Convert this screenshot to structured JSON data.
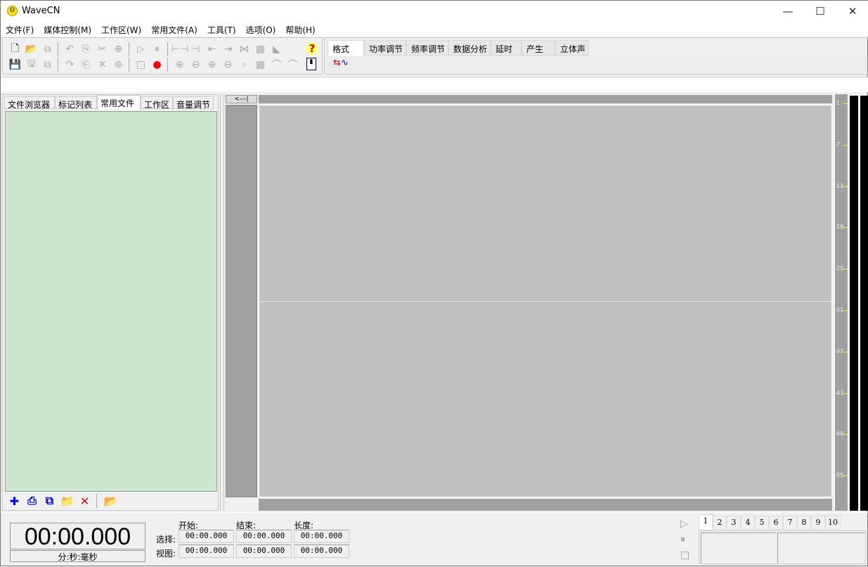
{
  "app": {
    "title": "WaveCN",
    "icon": "wavecn-logo-icon"
  },
  "window_controls": [
    {
      "name": "minimize-button",
      "glyph": "—"
    },
    {
      "name": "maximize-button",
      "glyph": "☐"
    },
    {
      "name": "close-button",
      "glyph": "✕"
    }
  ],
  "menu": [
    "文件(F)",
    "媒体控制(M)",
    "工作区(W)",
    "常用文件(A)",
    "工具(T)",
    "选项(O)",
    "帮助(H)"
  ],
  "toolbar": {
    "row1": [
      {
        "n": "new-file-icon",
        "g": "🗋",
        "c": "#000"
      },
      {
        "n": "open-folder-icon",
        "g": "📂",
        "c": "#c8b000"
      },
      {
        "n": "close-file-icon",
        "g": "⧉"
      },
      {
        "n": "sep"
      },
      {
        "n": "undo-icon",
        "g": "↶"
      },
      {
        "n": "copy-to-icon",
        "g": "⎘"
      },
      {
        "n": "cut-icon",
        "g": "✂"
      },
      {
        "n": "paste-new-icon",
        "g": "⊕"
      },
      {
        "n": "sep"
      },
      {
        "n": "play-icon",
        "g": "▷"
      },
      {
        "n": "pause-icon",
        "g": "⏸"
      },
      {
        "n": "sep"
      },
      {
        "n": "select-all-icon",
        "g": "⊢⊣"
      },
      {
        "n": "select-view-icon",
        "g": "⊣"
      },
      {
        "n": "select-start-icon",
        "g": "⇤"
      },
      {
        "n": "select-end-icon",
        "g": "⇥"
      },
      {
        "n": "select-range-icon",
        "g": "⋈"
      },
      {
        "n": "select-region-icon",
        "g": "▦"
      },
      {
        "n": "marker-icon",
        "g": "◣"
      }
    ],
    "row2": [
      {
        "n": "save-icon",
        "g": "💾"
      },
      {
        "n": "save-as-icon",
        "g": "🖫"
      },
      {
        "n": "save-all-icon",
        "g": "⧉"
      },
      {
        "n": "sep"
      },
      {
        "n": "redo-icon",
        "g": "↷"
      },
      {
        "n": "copy-icon",
        "g": "⎗"
      },
      {
        "n": "delete-icon",
        "g": "✕"
      },
      {
        "n": "paste-mix-icon",
        "g": "⊛"
      },
      {
        "n": "sep"
      },
      {
        "n": "stop-icon",
        "g": "□"
      },
      {
        "n": "record-icon",
        "g": "●",
        "c": "#f00"
      },
      {
        "n": "sep"
      },
      {
        "n": "zoom-in-icon",
        "g": "⊕"
      },
      {
        "n": "zoom-out-icon",
        "g": "⊖"
      },
      {
        "n": "zoom-in-vertical-icon",
        "g": "⊕"
      },
      {
        "n": "zoom-out-vertical-icon",
        "g": "⊖"
      },
      {
        "n": "zoom-full-icon",
        "g": "⌕"
      },
      {
        "n": "zoom-selection-icon",
        "g": "▦"
      },
      {
        "n": "zoom-left-icon",
        "g": "⌒"
      },
      {
        "n": "zoom-right-icon",
        "g": "⌒"
      }
    ],
    "help_icon": "help-icon",
    "audio_props_icon": "audio-properties-icon"
  },
  "ribbon": {
    "tabs": [
      "格式",
      "功率调节",
      "频率调节",
      "数据分析",
      "延时",
      "产生",
      "立体声"
    ],
    "active": 0,
    "tool_icon": "convert-format-icon"
  },
  "left_panel": {
    "tabs": [
      "文件浏览器",
      "标记列表",
      "常用文件",
      "工作区",
      "音量调节"
    ],
    "active": 2,
    "tools": [
      {
        "n": "add-icon",
        "g": "✚",
        "c": "#00f"
      },
      {
        "n": "add-file-icon",
        "g": "⎙",
        "c": "#00f"
      },
      {
        "n": "copy-file-icon",
        "g": "⧉",
        "c": "#00f"
      },
      {
        "n": "add-folder-icon",
        "g": "📁",
        "c": "#00f"
      },
      {
        "n": "remove-icon",
        "g": "✕",
        "c": "#e00"
      },
      {
        "n": "sep"
      },
      {
        "n": "open-checked-folder-icon",
        "g": "📂",
        "c": "#2a2"
      }
    ]
  },
  "wave": {
    "back_button": "<---|"
  },
  "meter_scale": [
    "-1",
    "-7",
    "-13",
    "-19",
    "-25",
    "-31",
    "-37",
    "-43",
    "-49",
    "-55"
  ],
  "time": {
    "display": "00:00.000",
    "unit": "分:秒:毫秒"
  },
  "selection": {
    "headers": [
      "开始:",
      "结束:",
      "长度:"
    ],
    "rows": [
      {
        "label": "选择:",
        "values": [
          "00:00.000",
          "00:00.000",
          "00:00.000"
        ]
      },
      {
        "label": "视图:",
        "values": [
          "00:00.000",
          "00:00.000",
          "00:00.000"
        ]
      }
    ]
  },
  "player": {
    "controls": [
      {
        "n": "play-icon",
        "g": "▷"
      },
      {
        "n": "pause-icon",
        "g": "⏸"
      },
      {
        "n": "stop-icon",
        "g": "□"
      }
    ],
    "tabs": [
      "1",
      "2",
      "3",
      "4",
      "5",
      "6",
      "7",
      "8",
      "9",
      "10"
    ],
    "active": 0
  }
}
